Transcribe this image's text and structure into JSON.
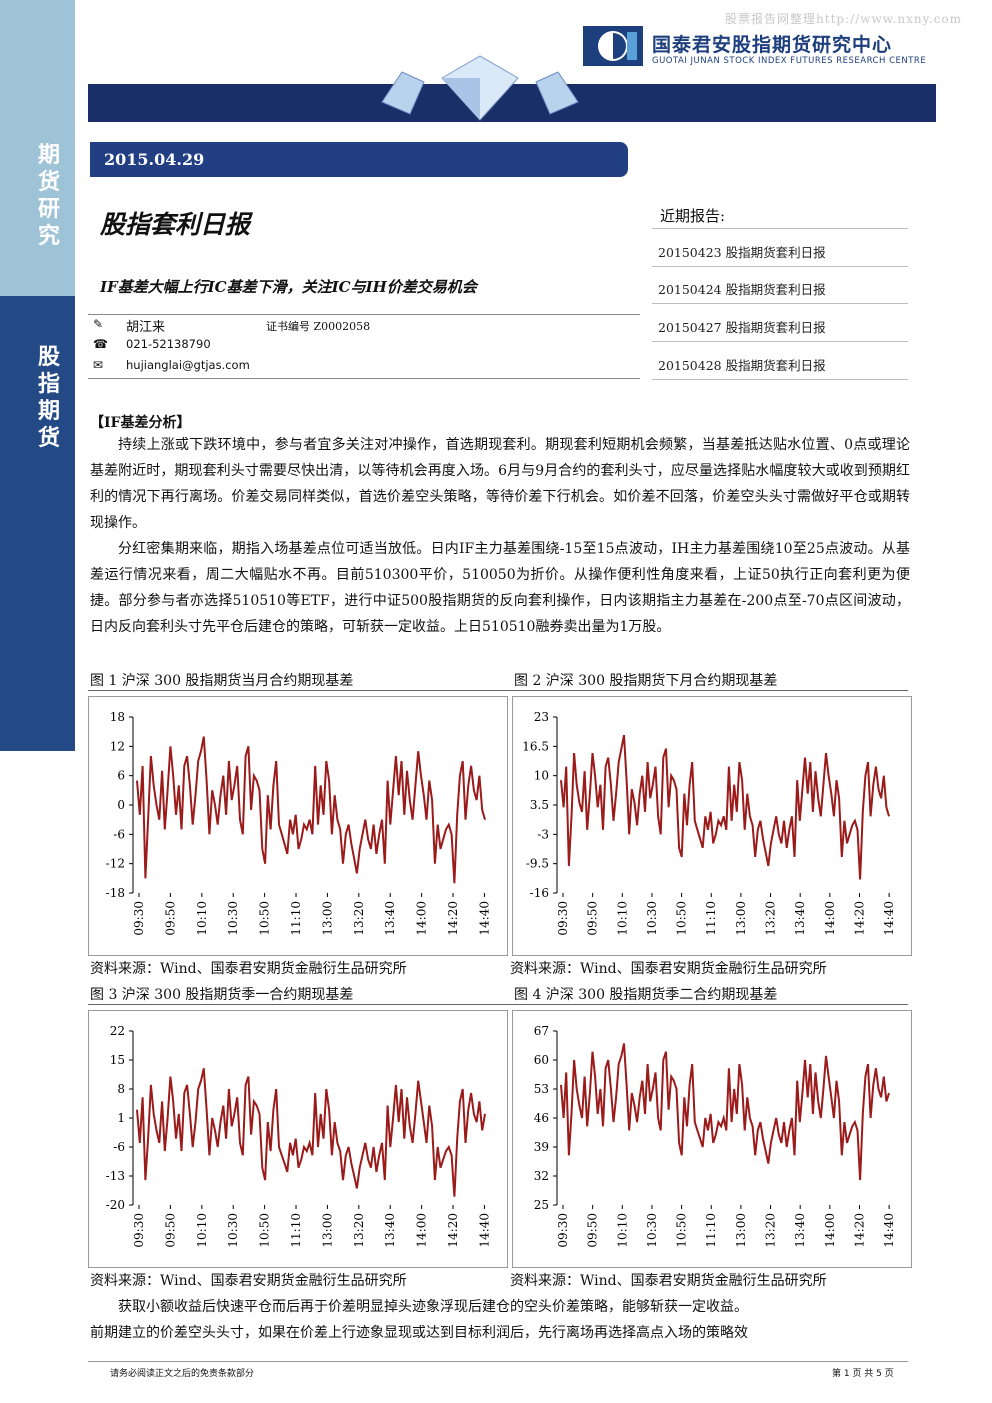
{
  "watermark": "股票报告网整理http://www.nxny.com",
  "logo": {
    "cn": "国泰君安股指期货研究中心",
    "en": "GUOTAI JUNAN STOCK INDEX FUTURES RESEARCH CENTRE"
  },
  "sidebar": {
    "top_label": "期货研究",
    "bottom_label": "股指期货"
  },
  "date": "2015.04.29",
  "report_title": "股指套利日报",
  "subtitle": "IF基差大幅上行IC基差下滑，关注IC与IH价差交易机会",
  "author": {
    "name": "胡江来",
    "cert": "证书编号 Z0002058",
    "phone": "021-52138790",
    "email": "hujianglai@gtjas.com"
  },
  "recent": {
    "heading": "近期报告:",
    "items": [
      "20150423 股指期货套利日报",
      "20150424 股指期货套利日报",
      "20150427 股指期货套利日报",
      "20150428 股指期货套利日报"
    ]
  },
  "section_heading": "【IF基差分析】",
  "paragraphs": [
    "持续上涨或下跌环境中，参与者宜多关注对冲操作，首选期现套利。期现套利短期机会频繁，当基差抵达贴水位置、0点或理论基差附近时，期现套利头寸需要尽快出清，以等待机会再度入场。6月与9月合约的套利头寸，应尽量选择贴水幅度较大或收到预期红利的情况下再行离场。价差交易同样类似，首选价差空头策略，等待价差下行机会。如价差不回落，价差空头头寸需做好平仓或期转现操作。",
    "分红密集期来临，期指入场基差点位可适当放低。日内IF主力基差围绕-15至15点波动，IH主力基差围绕10至25点波动。从基差运行情况来看，周二大幅贴水不再。目前510300平价，510050为折价。从操作便利性角度来看，上证50执行正向套利更为便捷。部分参与者亦选择510510等ETF，进行中证500股指期货的反向套利操作，日内该期指主力基差在-200点至-70点区间波动，日内反向套利头寸先平仓后建仓的策略，可斩获一定收益。上日510510融券卖出量为1万股。"
  ],
  "bottom_paragraph": [
    "获取小额收益后快速平仓而后再于价差明显掉头迹象浮现后建仓的空头价差策略，能够斩获一定收益。",
    "前期建立的价差空头头寸，如果在价差上行迹象显现或达到目标利润后，先行离场再选择高点入场的策略效"
  ],
  "source_label": "资料来源：Wind、国泰君安期货金融衍生品研究所",
  "xticks": [
    "09:30",
    "09:50",
    "10:10",
    "10:30",
    "10:50",
    "11:10",
    "13:00",
    "13:20",
    "13:40",
    "14:00",
    "14:20",
    "14:40"
  ],
  "chart_data": [
    {
      "type": "line",
      "title": "图 1 沪深 300 股指期货当月合约期现基差",
      "ylim": [
        -18,
        18
      ],
      "yticks": [
        "18",
        "12",
        "6",
        "0",
        "-6",
        "-12",
        "-18"
      ],
      "values": [
        5,
        -2,
        8,
        -15,
        -3,
        10,
        4,
        0,
        -3,
        7,
        -5,
        3,
        12,
        6,
        -2,
        4,
        -5,
        8,
        10,
        4,
        -4,
        2,
        9,
        11,
        14,
        5,
        -6,
        3,
        0,
        -4,
        2,
        6,
        -2,
        9,
        1,
        4,
        8,
        -3,
        -6,
        10,
        12,
        -1,
        6,
        5,
        3,
        -9,
        -12,
        2,
        -5,
        4,
        9,
        -4,
        -6,
        -8,
        -10,
        -3,
        -6,
        -2,
        -9,
        -7,
        -4,
        -5,
        -3,
        -6,
        8,
        -4,
        4,
        -2,
        9,
        5,
        -6,
        2,
        -3,
        -5,
        -12,
        -6,
        -4,
        -8,
        -11,
        -14,
        -9,
        -6,
        -3,
        -7,
        -9,
        -4,
        -10,
        -6,
        -3,
        -12,
        5,
        -4,
        3,
        10,
        2,
        9,
        -2,
        7,
        1,
        -3,
        4,
        11,
        6,
        2,
        -3,
        5,
        1,
        -12,
        -4,
        -9,
        -7,
        -5,
        -4,
        -6,
        -16,
        -2,
        6,
        9,
        -3,
        4,
        8,
        3,
        1,
        6,
        -1,
        -3
      ]
    },
    {
      "type": "line",
      "title": "图 2 沪深 300 股指期货下月合约期现基差",
      "ylim": [
        -16,
        23
      ],
      "yticks": [
        "23",
        "16.5",
        "10",
        "3.5",
        "-3",
        "-9.5",
        "-16"
      ],
      "values": [
        9,
        3,
        12,
        -10,
        1,
        15,
        8,
        4,
        2,
        11,
        -2,
        6,
        15,
        10,
        3,
        8,
        -2,
        12,
        14,
        8,
        0,
        6,
        13,
        16,
        19,
        9,
        -3,
        7,
        4,
        -1,
        6,
        10,
        2,
        13,
        5,
        8,
        12,
        1,
        -3,
        14,
        16,
        3,
        10,
        9,
        7,
        -6,
        -8,
        6,
        -1,
        8,
        13,
        0,
        -2,
        -4,
        -6,
        1,
        -2,
        2,
        -5,
        -3,
        0,
        -1,
        1,
        -2,
        12,
        0,
        8,
        2,
        13,
        9,
        -2,
        6,
        1,
        -1,
        -8,
        -2,
        0,
        -4,
        -7,
        -10,
        -5,
        -2,
        1,
        -3,
        -5,
        0,
        -6,
        -2,
        1,
        -8,
        9,
        0,
        7,
        14,
        6,
        13,
        2,
        11,
        5,
        1,
        8,
        15,
        10,
        6,
        1,
        9,
        5,
        -8,
        0,
        -5,
        -3,
        -1,
        0,
        -2,
        -13,
        2,
        10,
        13,
        1,
        8,
        12,
        7,
        5,
        10,
        3,
        1
      ]
    },
    {
      "type": "line",
      "title": "图 3 沪深 300 股指期货季一合约期现基差",
      "ylim": [
        -20,
        22
      ],
      "yticks": [
        "22",
        "15",
        "8",
        "1",
        "-6",
        "-13",
        "-20"
      ],
      "values": [
        3,
        -5,
        6,
        -14,
        -4,
        9,
        2,
        -2,
        -5,
        5,
        -7,
        1,
        11,
        5,
        -4,
        2,
        -7,
        7,
        9,
        2,
        -6,
        0,
        8,
        10,
        13,
        3,
        -8,
        1,
        -2,
        -6,
        0,
        4,
        -4,
        8,
        -1,
        2,
        6,
        -5,
        -8,
        9,
        11,
        -3,
        5,
        4,
        2,
        -11,
        -14,
        0,
        -7,
        3,
        8,
        -6,
        -8,
        -10,
        -12,
        -5,
        -8,
        -4,
        -11,
        -9,
        -6,
        -7,
        -5,
        -8,
        7,
        -6,
        2,
        -4,
        8,
        3,
        -8,
        0,
        -5,
        -7,
        -14,
        -8,
        -6,
        -10,
        -13,
        -16,
        -11,
        -8,
        -5,
        -9,
        -11,
        -6,
        -12,
        -8,
        -5,
        -14,
        4,
        -6,
        1,
        9,
        0,
        8,
        -4,
        6,
        -1,
        -5,
        2,
        10,
        5,
        0,
        -5,
        4,
        -1,
        -14,
        -6,
        -11,
        -9,
        -7,
        -6,
        -8,
        -18,
        -4,
        5,
        8,
        -5,
        3,
        7,
        2,
        0,
        5,
        -2,
        2
      ]
    },
    {
      "type": "line",
      "title": "图 4 沪深 300 股指期货季二合约期现基差",
      "ylim": [
        25,
        67
      ],
      "yticks": [
        "67",
        "60",
        "53",
        "46",
        "39",
        "32",
        "25"
      ],
      "values": [
        54,
        46,
        57,
        37,
        47,
        60,
        53,
        49,
        46,
        56,
        44,
        52,
        62,
        56,
        47,
        53,
        44,
        58,
        60,
        53,
        45,
        51,
        59,
        61,
        64,
        54,
        43,
        52,
        49,
        45,
        51,
        55,
        47,
        59,
        50,
        53,
        57,
        46,
        43,
        60,
        62,
        48,
        56,
        55,
        53,
        40,
        37,
        51,
        44,
        54,
        59,
        45,
        43,
        41,
        39,
        46,
        43,
        47,
        40,
        42,
        45,
        44,
        46,
        43,
        58,
        45,
        53,
        47,
        59,
        54,
        43,
        51,
        46,
        44,
        37,
        43,
        45,
        41,
        38,
        35,
        40,
        43,
        46,
        42,
        40,
        45,
        39,
        43,
        46,
        37,
        55,
        45,
        52,
        60,
        51,
        59,
        47,
        57,
        50,
        46,
        53,
        61,
        56,
        51,
        46,
        55,
        50,
        37,
        45,
        40,
        42,
        44,
        45,
        43,
        31,
        47,
        56,
        59,
        46,
        54,
        58,
        53,
        51,
        56,
        50,
        52
      ]
    }
  ]
}
